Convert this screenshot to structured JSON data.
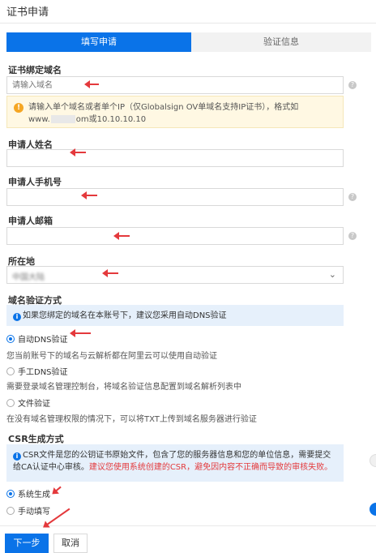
{
  "dialog": {
    "title": "证书申请"
  },
  "steps": [
    {
      "label": "填写申请"
    },
    {
      "label": "验证信息"
    }
  ],
  "domain": {
    "label": "证书绑定域名",
    "placeholder": "请输入域名",
    "warning_line1": "请输入单个域名或者单个IP（仅Globalsign OV单域名支持IP证书），格式如",
    "warning_prefix": "www.",
    "warning_suffix": "om或10.10.10.10"
  },
  "applicant_name": {
    "label": "申请人姓名"
  },
  "applicant_phone": {
    "label": "申请人手机号"
  },
  "applicant_email": {
    "label": "申请人邮箱"
  },
  "location": {
    "label": "所在地",
    "value": "中国大陆"
  },
  "verification": {
    "label": "域名验证方式",
    "tip": "如果您绑定的域名在本账号下，建议您采用自动DNS验证",
    "options": [
      {
        "label": "自动DNS验证",
        "desc": "您当前账号下的域名与云解析都在阿里云可以使用自动验证",
        "selected": true
      },
      {
        "label": "手工DNS验证",
        "desc": "需要登录域名管理控制台，将域名验证信息配置到域名解析列表中",
        "selected": false
      },
      {
        "label": "文件验证",
        "desc": "在没有域名管理权限的情况下，可以将TXT上传到域名服务器进行验证",
        "selected": false
      }
    ]
  },
  "csr": {
    "label": "CSR生成方式",
    "tip": "CSR文件是您的公钥证书原始文件，包含了您的服务器信息和您的单位信息，需要提交给CA认证中心审核。",
    "tip_warning": "建议您使用系统创建的CSR，避免因内容不正确而导致的审核失败。",
    "options": [
      {
        "label": "系统生成",
        "selected": true
      },
      {
        "label": "手动填写",
        "selected": false
      }
    ]
  },
  "footer": {
    "next_label": "下一步",
    "cancel_label": "取消"
  },
  "colors": {
    "primary": "#0a73e8",
    "annotation_arrow": "#e4393c"
  }
}
